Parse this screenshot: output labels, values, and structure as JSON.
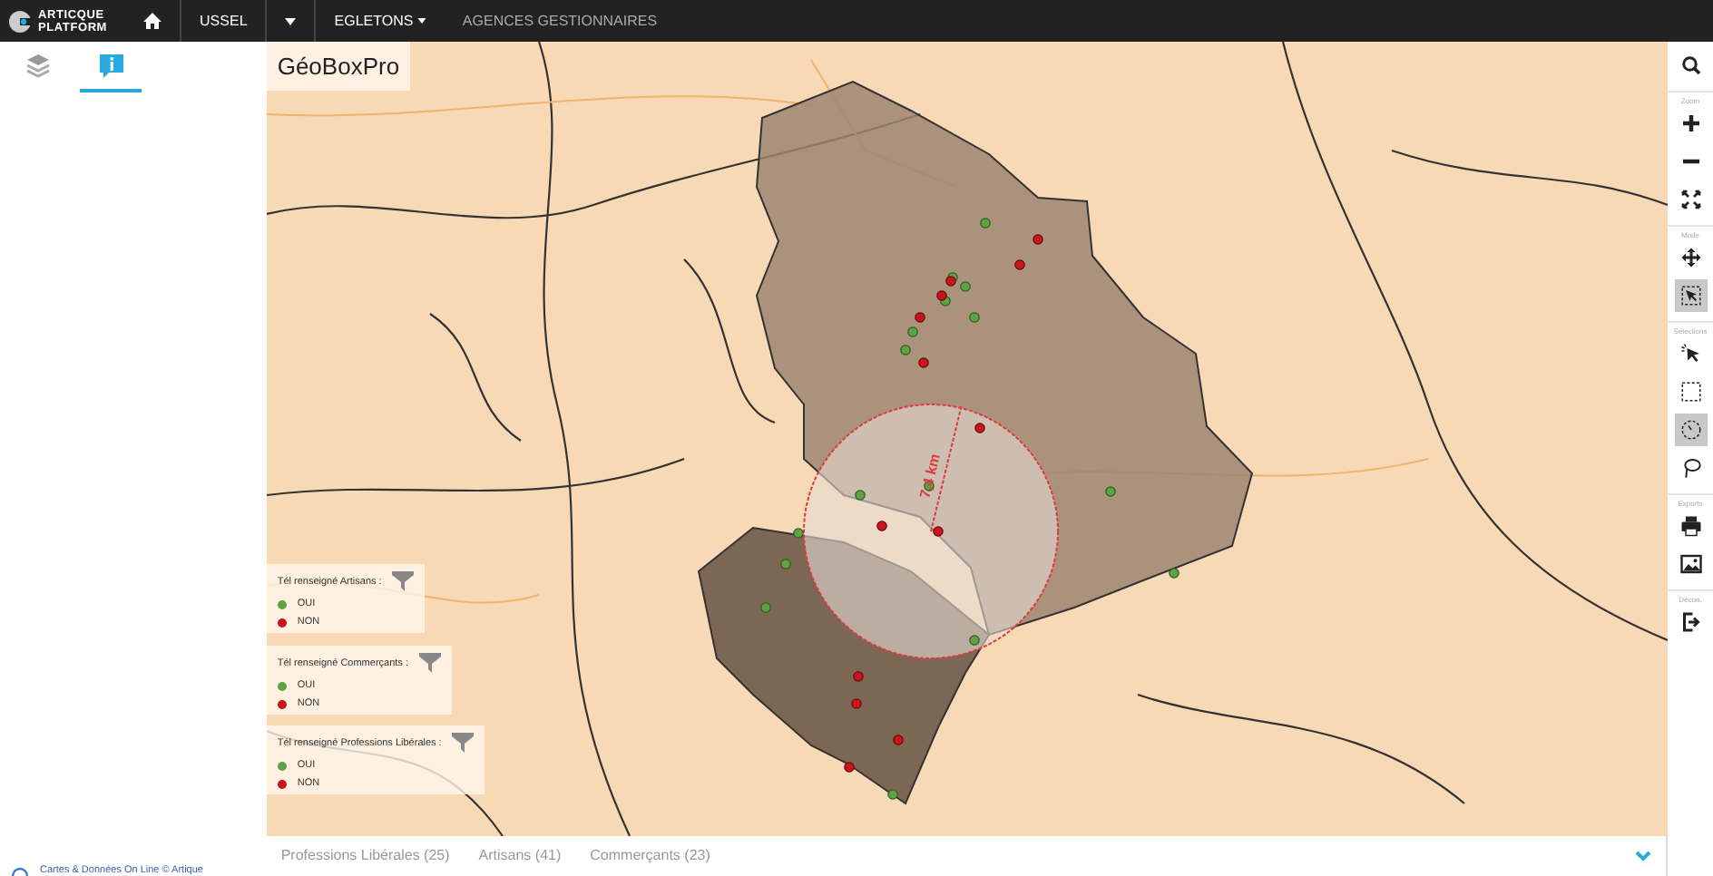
{
  "topbar": {
    "logo": [
      "ARTICQUE",
      "PLATFORM"
    ],
    "items": [
      {
        "kind": "text",
        "label": "USSEL"
      },
      {
        "kind": "caret"
      },
      {
        "kind": "dropdown",
        "label": "EGLETONS"
      },
      {
        "kind": "muted",
        "label": "AGENCES GESTIONNAIRES"
      }
    ]
  },
  "sidebar": {
    "tabs": [
      {
        "kind": "layers",
        "selected": false
      },
      {
        "kind": "info",
        "selected": true
      }
    ],
    "footer": "Cartes & Données On Line © Artique"
  },
  "map": {
    "title": "GéoBoxPro",
    "radius_label": "7,4 km",
    "legends": [
      {
        "title": "Tél renseigné Artisans :",
        "entries": [
          {
            "label": "OUI",
            "color": "#5fa444"
          },
          {
            "label": "NON",
            "color": "#c8141a"
          }
        ]
      },
      {
        "title": "Tél renseigné Commerçants :",
        "entries": [
          {
            "label": "OUI",
            "color": "#5fa444"
          },
          {
            "label": "NON",
            "color": "#c8141a"
          }
        ]
      },
      {
        "title": "Tél renseigné Professions Libérales :",
        "entries": [
          {
            "label": "OUI",
            "color": "#5fa444"
          },
          {
            "label": "NON",
            "color": "#c8141a"
          }
        ]
      }
    ]
  },
  "toolbar": [
    {
      "kind": "search",
      "selected": false
    },
    {
      "kind": "label",
      "label": "Zoom"
    },
    {
      "kind": "plus",
      "selected": false
    },
    {
      "kind": "minus",
      "selected": false
    },
    {
      "kind": "fullscreen",
      "selected": false
    },
    {
      "kind": "label",
      "label": "Mode"
    },
    {
      "kind": "move",
      "selected": false
    },
    {
      "kind": "select",
      "selected": true
    },
    {
      "kind": "label",
      "label": "Sélections"
    },
    {
      "kind": "pointer",
      "selected": false
    },
    {
      "kind": "rect",
      "selected": false
    },
    {
      "kind": "circle",
      "selected": true
    },
    {
      "kind": "lasso",
      "selected": false
    },
    {
      "kind": "label",
      "label": "Exports"
    },
    {
      "kind": "print",
      "selected": false
    },
    {
      "kind": "image",
      "selected": false
    },
    {
      "kind": "label",
      "label": "Décon."
    },
    {
      "kind": "logout",
      "selected": false
    }
  ],
  "bottom_tabs": [
    {
      "label": "Professions Libérales (25)",
      "selected": false
    },
    {
      "label": "Artisans (41)",
      "selected": false
    },
    {
      "label": "Commerçants (23)",
      "selected": false
    }
  ]
}
